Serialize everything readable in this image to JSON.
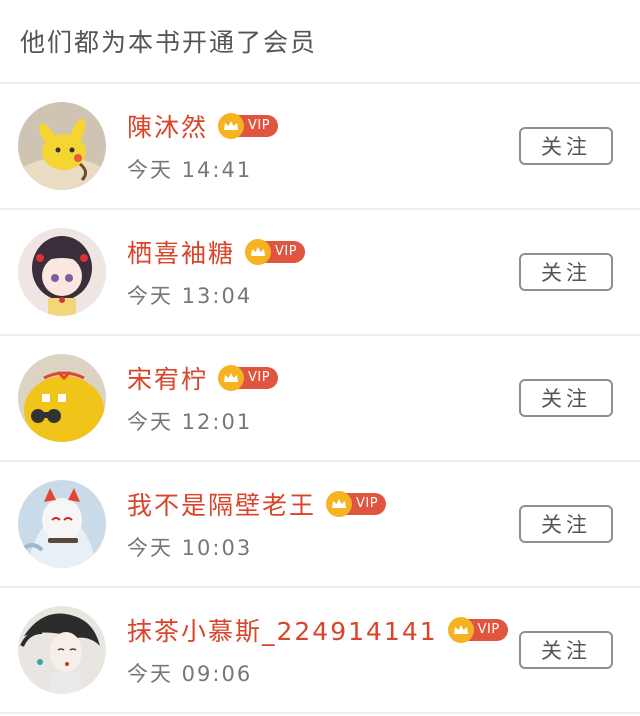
{
  "header": {
    "title": "他们都为本书开通了会员"
  },
  "vip_label": "VIP",
  "follow_label": "关注",
  "members": [
    {
      "name": "陳沐然",
      "time": "今天 14:41",
      "avatar": "pikachu"
    },
    {
      "name": "栖喜袖糖",
      "time": "今天 13:04",
      "avatar": "anime-girl"
    },
    {
      "name": "宋宥柠",
      "time": "今天 12:01",
      "avatar": "plush-toy"
    },
    {
      "name": "我不是隔壁老王",
      "time": "今天 10:03",
      "avatar": "masked-character"
    },
    {
      "name": "抹茶小慕斯_224914141",
      "time": "今天 09:06",
      "avatar": "painted-girl"
    }
  ],
  "colors": {
    "name": "#d9442a",
    "vip": "#e0553f",
    "crown": "#f6b321"
  }
}
